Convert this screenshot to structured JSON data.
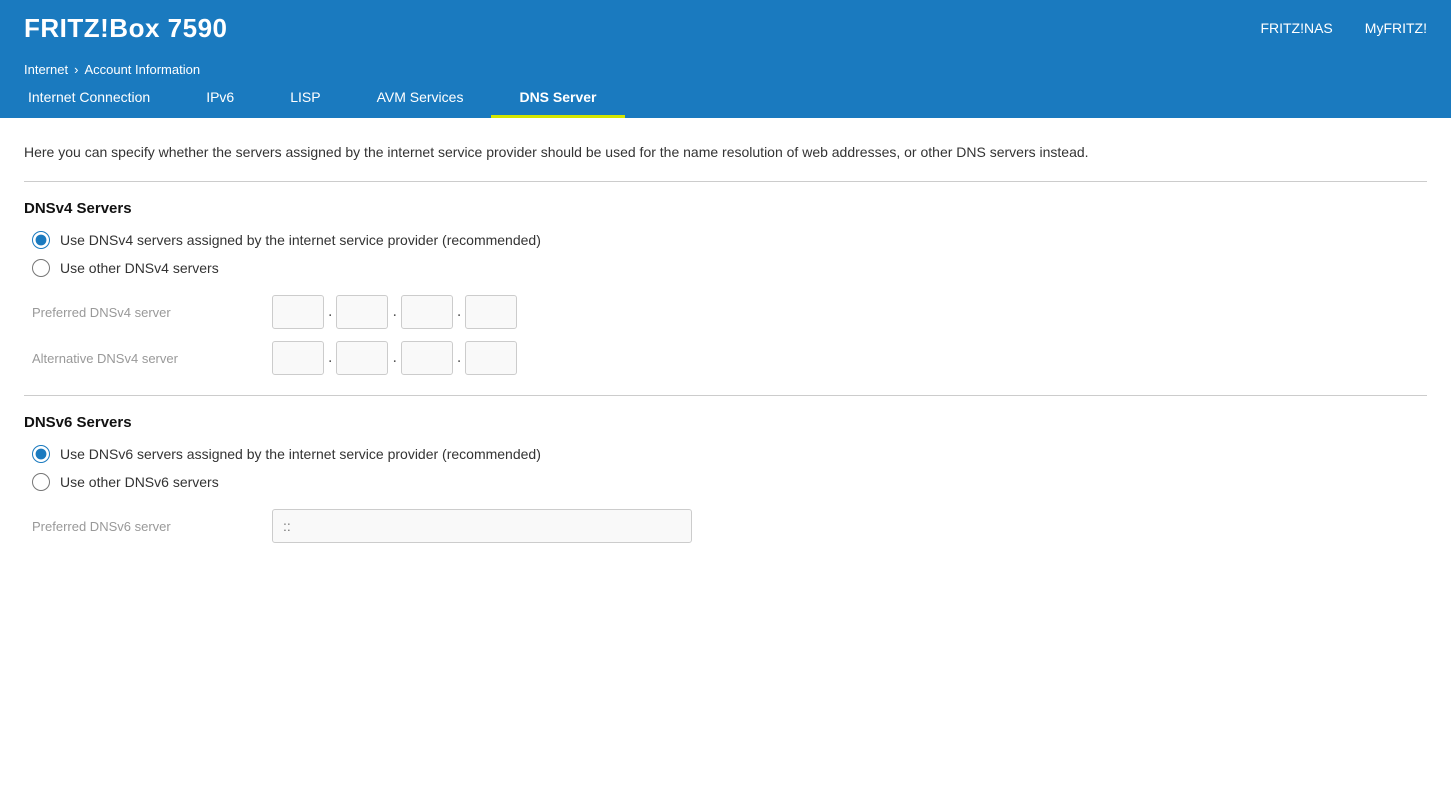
{
  "header": {
    "logo": "FRITZ!Box 7590",
    "nav": [
      {
        "label": "FRITZ!NAS",
        "name": "fritznas-link"
      },
      {
        "label": "MyFRITZ!",
        "name": "myfritz-link"
      }
    ]
  },
  "breadcrumb": {
    "items": [
      {
        "label": "Internet",
        "name": "breadcrumb-internet"
      },
      {
        "label": "Account Information",
        "name": "breadcrumb-account-information"
      }
    ],
    "separator": "›"
  },
  "tabs": [
    {
      "label": "Internet Connection",
      "name": "tab-internet-connection",
      "active": false
    },
    {
      "label": "IPv6",
      "name": "tab-ipv6",
      "active": false
    },
    {
      "label": "LISP",
      "name": "tab-lisp",
      "active": false
    },
    {
      "label": "AVM Services",
      "name": "tab-avm-services",
      "active": false
    },
    {
      "label": "DNS Server",
      "name": "tab-dns-server",
      "active": true
    }
  ],
  "description": "Here you can specify whether the servers assigned by the internet service provider should be used for the name resolution of web addresses, or other DNS servers instead.",
  "dnsv4": {
    "section_title": "DNSv4 Servers",
    "radio_isp": {
      "label": "Use DNSv4 servers assigned by the internet service provider (recommended)",
      "checked": true
    },
    "radio_other": {
      "label": "Use other DNSv4 servers",
      "checked": false
    },
    "preferred_label": "Preferred DNSv4 server",
    "alternative_label": "Alternative DNSv4 server"
  },
  "dnsv6": {
    "section_title": "DNSv6 Servers",
    "radio_isp": {
      "label": "Use DNSv6 servers assigned by the internet service provider (recommended)",
      "checked": true
    },
    "radio_other": {
      "label": "Use other DNSv6 servers",
      "checked": false
    },
    "preferred_label": "Preferred DNSv6 server",
    "preferred_placeholder": "::"
  }
}
